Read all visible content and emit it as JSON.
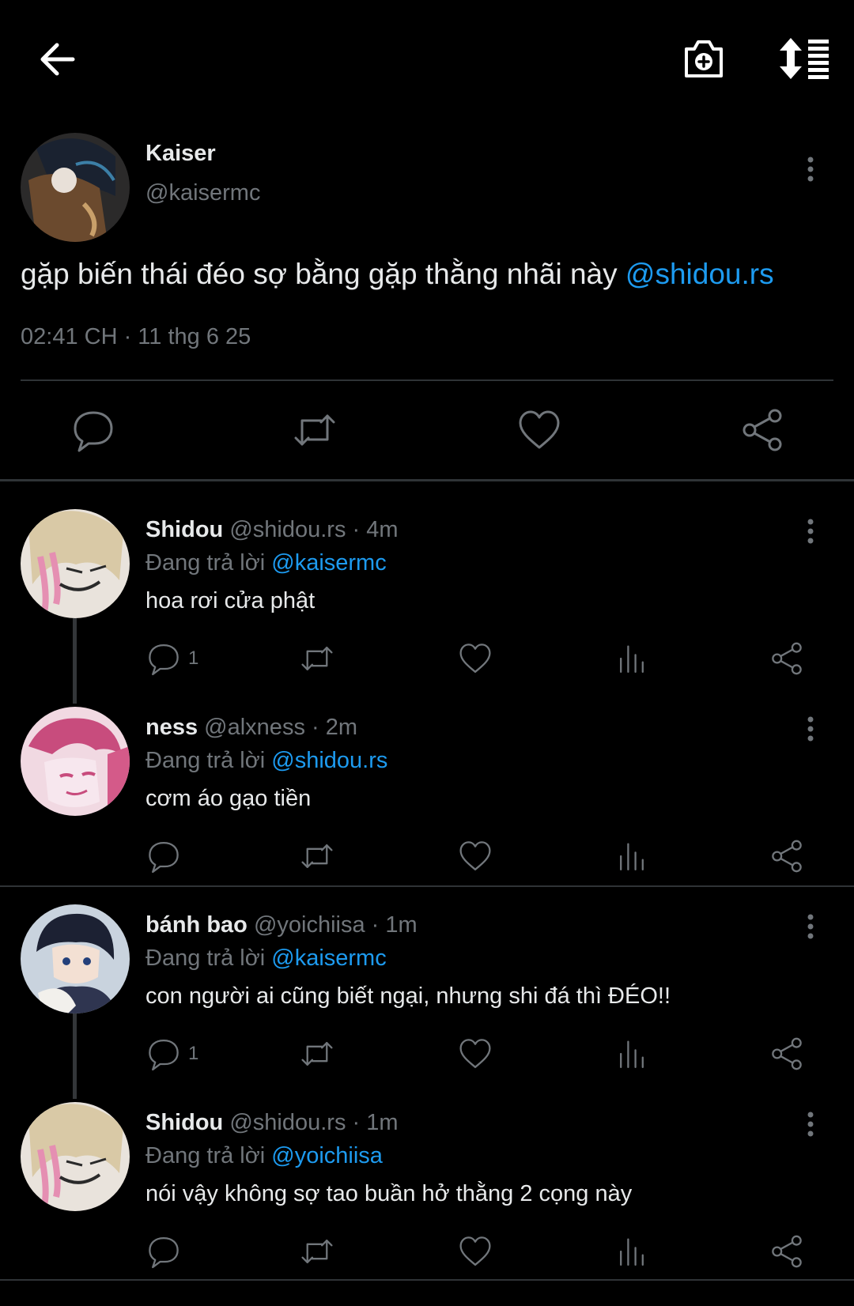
{
  "header": {
    "back_icon": "arrow-left-icon",
    "camera_icon": "camera-add-icon",
    "sort_icon": "sort-list-icon"
  },
  "main_tweet": {
    "name": "Kaiser",
    "handle": "@kaisermc",
    "text": "gặp biến thái đéo sợ bằng gặp thằng nhãi này ",
    "mention": "@shidou.rs",
    "timestamp": "02:41 CH · 11 thg 6 25"
  },
  "replies": [
    {
      "name": "Shidou",
      "meta": "@shidou.rs · 4m",
      "replying_label": "Đang trả lời ",
      "replying_to": "@kaisermc",
      "text": "hoa rơi cửa phật",
      "reply_count": "1"
    },
    {
      "name": "ness",
      "meta": "@alxness · 2m",
      "replying_label": "Đang trả lời ",
      "replying_to": "@shidou.rs",
      "text": "cơm áo gạo tiền",
      "reply_count": ""
    },
    {
      "name": "bánh bao",
      "meta": "@yoichiisa · 1m",
      "replying_label": "Đang trả lời ",
      "replying_to": "@kaisermc",
      "text": "con người ai cũng biết ngại, nhưng shi đá thì ĐÉO!!",
      "reply_count": "1"
    },
    {
      "name": "Shidou",
      "meta": "@shidou.rs · 1m",
      "replying_label": "Đang trả lời ",
      "replying_to": "@yoichiisa",
      "text": "nói vậy không sợ tao buần hở thằng 2 cọng này",
      "reply_count": ""
    }
  ],
  "colors": {
    "background": "#000000",
    "text": "#e7e9ea",
    "muted": "#71767b",
    "link": "#1d9bf0",
    "divider": "#2f3336"
  }
}
